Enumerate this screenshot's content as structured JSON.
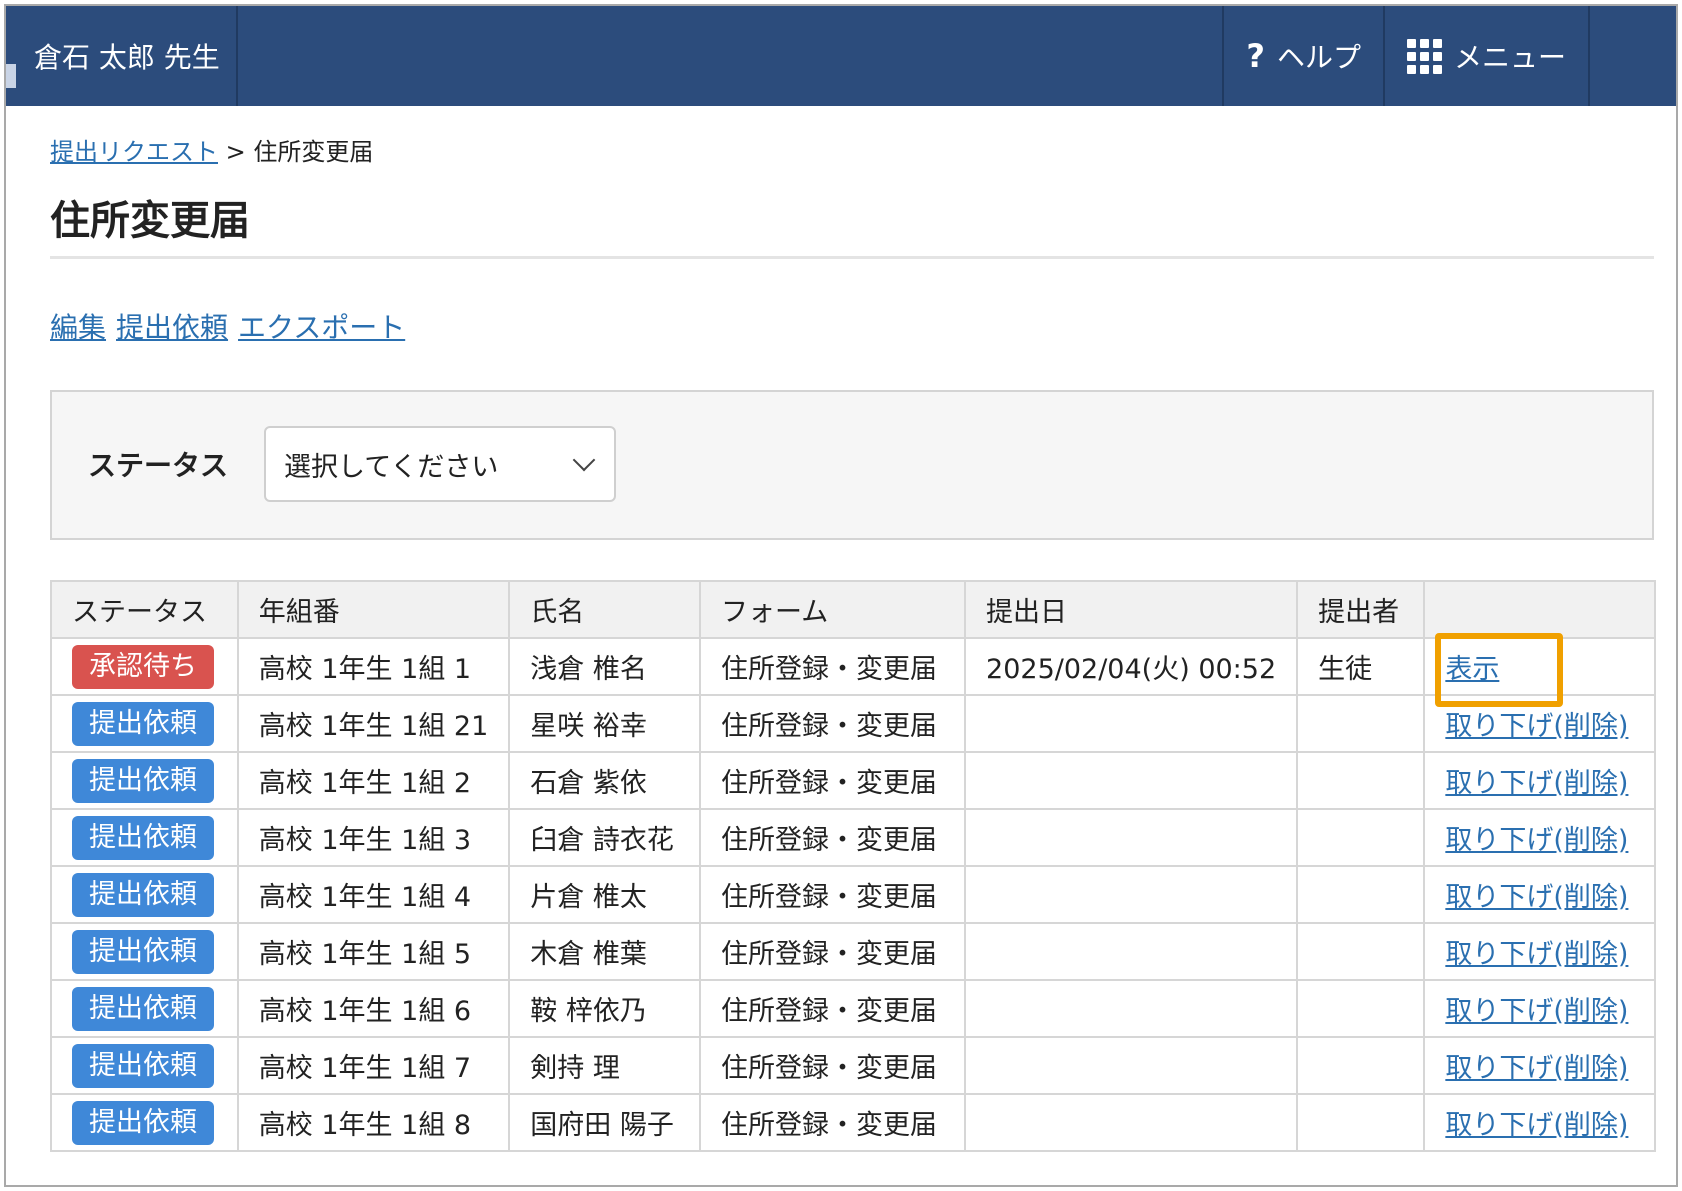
{
  "header": {
    "user_name": "倉石 太郎 先生",
    "help_label": "ヘルプ",
    "menu_label": "メニュー"
  },
  "breadcrumb": {
    "parent": "提出リクエスト",
    "separator": ">",
    "current": "住所変更届"
  },
  "page_title": "住所変更届",
  "actions": {
    "edit": "編集",
    "request": "提出依頼",
    "export": "エクスポート"
  },
  "filter": {
    "label": "ステータス",
    "select_value": "選択してください"
  },
  "colors": {
    "header_bg": "#2c4c7c",
    "badge_pending": "#d9534f",
    "badge_request": "#3f88d8",
    "link": "#2a6fb0",
    "highlight": "#f0a000"
  },
  "table": {
    "headers": [
      "ステータス",
      "年組番",
      "氏名",
      "フォーム",
      "提出日",
      "提出者",
      ""
    ],
    "rows": [
      {
        "status": "承認待ち",
        "class": "高校 1年生 1組 1",
        "name": "浅倉 椎名",
        "form": "住所登録・変更届",
        "date": "2025/02/04(火) 00:52",
        "submitter": "生徒",
        "action": "表示"
      },
      {
        "status": "提出依頼",
        "class": "高校 1年生 1組 21",
        "name": "星咲 裕幸",
        "form": "住所登録・変更届",
        "date": "",
        "submitter": "",
        "action": "取り下げ(削除)"
      },
      {
        "status": "提出依頼",
        "class": "高校 1年生 1組 2",
        "name": "石倉 紫依",
        "form": "住所登録・変更届",
        "date": "",
        "submitter": "",
        "action": "取り下げ(削除)"
      },
      {
        "status": "提出依頼",
        "class": "高校 1年生 1組 3",
        "name": "臼倉 詩衣花",
        "form": "住所登録・変更届",
        "date": "",
        "submitter": "",
        "action": "取り下げ(削除)"
      },
      {
        "status": "提出依頼",
        "class": "高校 1年生 1組 4",
        "name": "片倉 椎太",
        "form": "住所登録・変更届",
        "date": "",
        "submitter": "",
        "action": "取り下げ(削除)"
      },
      {
        "status": "提出依頼",
        "class": "高校 1年生 1組 5",
        "name": "木倉 椎葉",
        "form": "住所登録・変更届",
        "date": "",
        "submitter": "",
        "action": "取り下げ(削除)"
      },
      {
        "status": "提出依頼",
        "class": "高校 1年生 1組 6",
        "name": "鞍 梓依乃",
        "form": "住所登録・変更届",
        "date": "",
        "submitter": "",
        "action": "取り下げ(削除)"
      },
      {
        "status": "提出依頼",
        "class": "高校 1年生 1組 7",
        "name": "剣持 理",
        "form": "住所登録・変更届",
        "date": "",
        "submitter": "",
        "action": "取り下げ(削除)"
      },
      {
        "status": "提出依頼",
        "class": "高校 1年生 1組 8",
        "name": "国府田 陽子",
        "form": "住所登録・変更届",
        "date": "",
        "submitter": "",
        "action": "取り下げ(削除)"
      }
    ]
  }
}
